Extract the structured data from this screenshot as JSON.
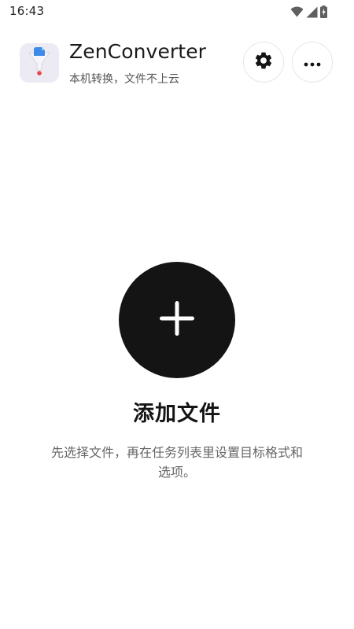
{
  "status_bar": {
    "time": "16:43",
    "icons": [
      "wifi-icon",
      "cellular-signal-icon",
      "battery-charging-icon"
    ]
  },
  "header": {
    "app_name": "ZenConverter",
    "subtitle": "本机转换，文件不上云",
    "app_icon": "funnel-logo-icon",
    "settings_icon": "gear-icon",
    "more_icon": "more-horizontal-icon"
  },
  "empty_state": {
    "add_icon": "plus-icon",
    "title": "添加文件",
    "description": "先选择文件，再在任务列表里设置目标格式和选项。"
  },
  "colors": {
    "background": "#ffffff",
    "primary_button": "#141414",
    "text_primary": "#1a1a1a",
    "text_secondary": "#666666",
    "app_icon_bg": "#ecebf3",
    "logo_blue": "#3d8be8",
    "logo_red": "#e84545"
  }
}
